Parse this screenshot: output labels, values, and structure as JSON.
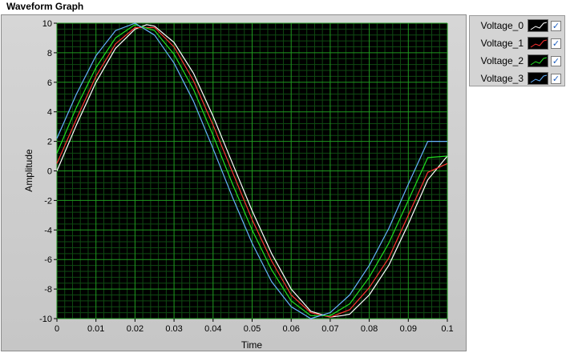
{
  "title": "Waveform Graph",
  "chart_data": {
    "type": "line",
    "xlabel": "Time",
    "ylabel": "Amplitude",
    "xlim": [
      0,
      0.1
    ],
    "ylim": [
      -10,
      10
    ],
    "x_ticks": [
      "0",
      "0.01",
      "0.02",
      "0.03",
      "0.04",
      "0.05",
      "0.06",
      "0.07",
      "0.08",
      "0.09",
      "0.1"
    ],
    "y_ticks": [
      "10",
      "8",
      "6",
      "4",
      "2",
      "0",
      "-2",
      "-4",
      "-6",
      "-8",
      "-10"
    ],
    "grid": true,
    "minor_grid": true,
    "background_color": "#000000",
    "grid_color": "#1f9a1f",
    "minor_grid_color": "#0f4a12",
    "legend_position": "right",
    "series": [
      {
        "name": "Voltage_0",
        "color": "#ffffff",
        "x": [
          0,
          0.005,
          0.01,
          0.015,
          0.02,
          0.023,
          0.025,
          0.03,
          0.035,
          0.04,
          0.045,
          0.05,
          0.055,
          0.06,
          0.065,
          0.07,
          0.073,
          0.075,
          0.08,
          0.085,
          0.09,
          0.095,
          0.1
        ],
        "values": [
          0,
          3.1,
          6.0,
          8.3,
          9.6,
          9.9,
          9.8,
          8.7,
          6.6,
          3.7,
          0.5,
          -2.7,
          -5.6,
          -8.0,
          -9.5,
          -9.9,
          -9.8,
          -9.7,
          -8.4,
          -6.4,
          -3.6,
          -0.6,
          1.0
        ]
      },
      {
        "name": "Voltage_1",
        "color": "#ff3030",
        "x": [
          0,
          0.005,
          0.01,
          0.015,
          0.02,
          0.025,
          0.03,
          0.035,
          0.04,
          0.045,
          0.05,
          0.055,
          0.06,
          0.065,
          0.07,
          0.075,
          0.08,
          0.085,
          0.09,
          0.095,
          0.1
        ],
        "values": [
          0.5,
          3.5,
          6.4,
          8.6,
          9.7,
          9.7,
          8.4,
          6.1,
          3.1,
          -0.1,
          -3.3,
          -6.1,
          -8.4,
          -9.6,
          -9.9,
          -9.4,
          -7.9,
          -5.9,
          -3.0,
          -0.1,
          0.5
        ]
      },
      {
        "name": "Voltage_2",
        "color": "#20e020",
        "x": [
          0,
          0.005,
          0.01,
          0.015,
          0.02,
          0.025,
          0.03,
          0.035,
          0.04,
          0.045,
          0.05,
          0.055,
          0.06,
          0.065,
          0.07,
          0.075,
          0.08,
          0.085,
          0.09,
          0.095,
          0.1
        ],
        "values": [
          1.2,
          4.3,
          7.0,
          9.0,
          9.9,
          9.5,
          7.9,
          5.5,
          2.4,
          -0.9,
          -4.0,
          -6.7,
          -8.8,
          -9.8,
          -9.8,
          -9.0,
          -7.2,
          -4.9,
          -2.0,
          0.9,
          1.0
        ]
      },
      {
        "name": "Voltage_3",
        "color": "#66b3ff",
        "x": [
          0,
          0.005,
          0.01,
          0.015,
          0.02,
          0.025,
          0.03,
          0.035,
          0.04,
          0.045,
          0.05,
          0.055,
          0.06,
          0.065,
          0.07,
          0.075,
          0.08,
          0.085,
          0.09,
          0.095,
          0.1
        ],
        "values": [
          2.2,
          5.2,
          7.8,
          9.5,
          10.0,
          9.2,
          7.3,
          4.7,
          1.5,
          -1.8,
          -4.9,
          -7.5,
          -9.2,
          -10.0,
          -9.6,
          -8.4,
          -6.4,
          -3.9,
          -0.9,
          2.0,
          2.0
        ]
      }
    ]
  }
}
